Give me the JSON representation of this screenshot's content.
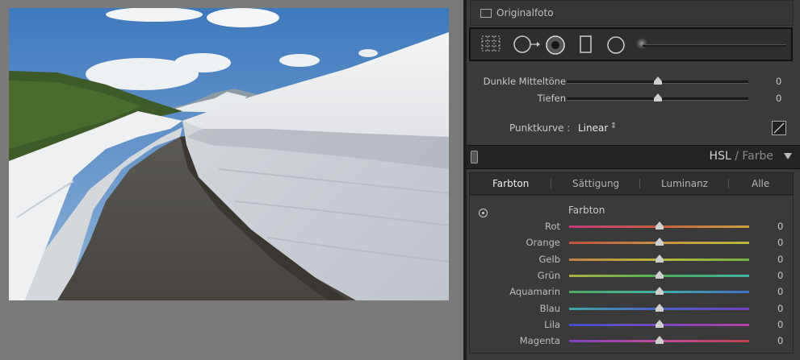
{
  "original_photo": {
    "label": "Originalfoto"
  },
  "tone": {
    "rows": [
      {
        "label": "Dunkle Mitteltöne",
        "value": "0"
      },
      {
        "label": "Tiefen",
        "value": "0"
      }
    ]
  },
  "point_curve": {
    "label": "Punktkurve :",
    "value": "Linear",
    "arrows": "⇕"
  },
  "hsl_panel": {
    "title_active": "HSL",
    "title_sep": " / ",
    "title_other": "Farbe",
    "tabs": [
      "Farbton",
      "Sättigung",
      "Luminanz",
      "Alle"
    ],
    "active_tab": "Farbton",
    "section": "Farbton",
    "rows": [
      {
        "label": "Rot",
        "value": "0",
        "color": "#c0504a"
      },
      {
        "label": "Orange",
        "value": "0",
        "color": "#c0a040"
      },
      {
        "label": "Gelb",
        "value": "0",
        "color": "#b8b83c"
      },
      {
        "label": "Grün",
        "value": "0",
        "color": "#50b05a"
      },
      {
        "label": "Aquamarin",
        "value": "0",
        "color": "#40b0a8"
      },
      {
        "label": "Blau",
        "value": "0",
        "color": "#4a60c8"
      },
      {
        "label": "Lila",
        "value": "0",
        "color": "#7a4ac0"
      },
      {
        "label": "Magenta",
        "value": "0",
        "color": "#c04a9a"
      }
    ]
  }
}
